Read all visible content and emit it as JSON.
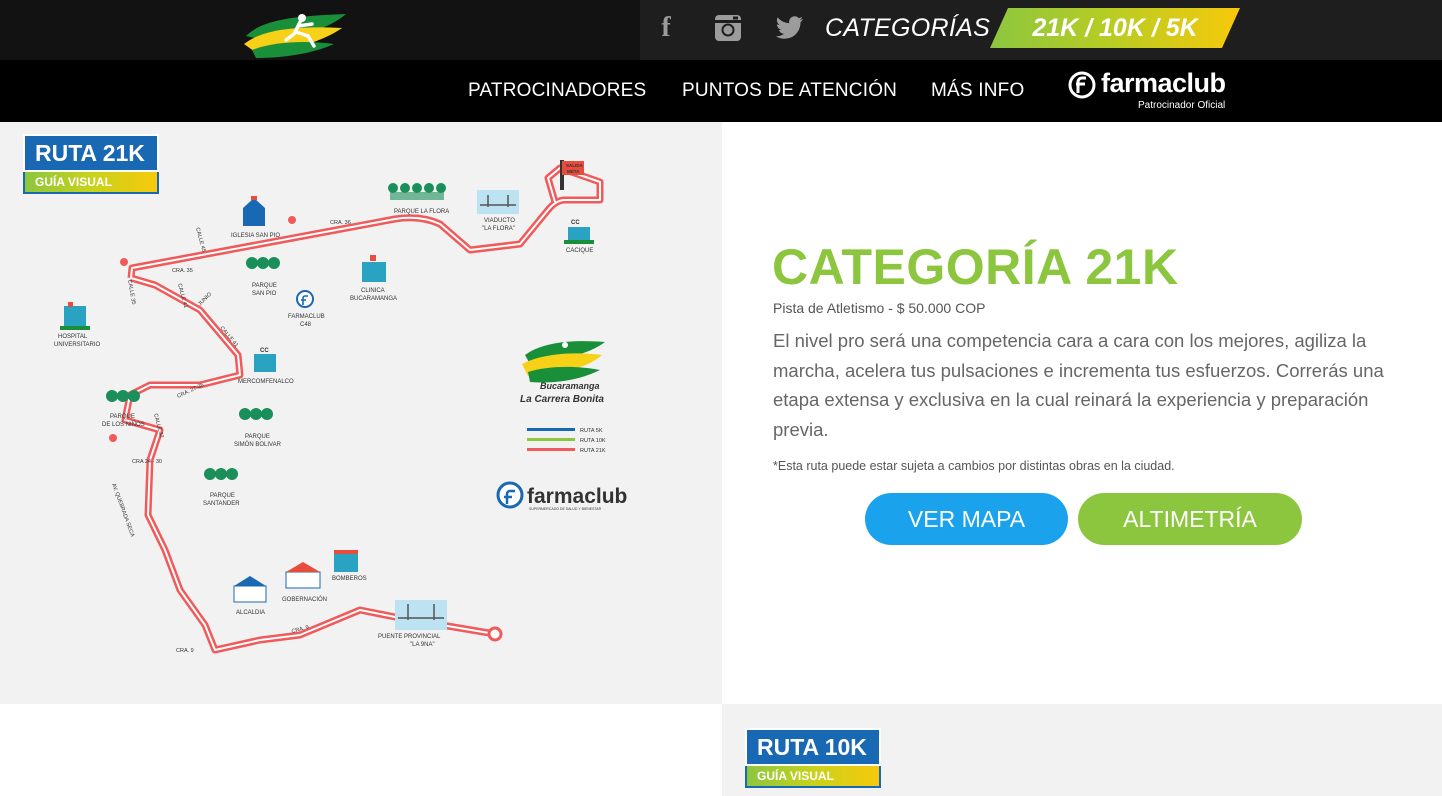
{
  "header": {
    "logo_icon": "brazil-runner-logo",
    "social": [
      {
        "name": "facebook",
        "glyph": "f"
      },
      {
        "name": "instagram"
      },
      {
        "name": "twitter"
      }
    ],
    "categorias_label": "CATEGORÍAS",
    "categories_badge": "21K / 10K / 5K"
  },
  "nav": {
    "items": [
      "PATROCINADORES",
      "PUNTOS DE ATENCIÓN",
      "MÁS INFO"
    ],
    "sponsor_name": "farmaclub",
    "sponsor_sub": "Patrocinador Oficial"
  },
  "map": {
    "badge_title": "RUTA 21K",
    "badge_sub": "GUÍA VISUAL",
    "route_color": "#f05a5a",
    "labels": {
      "salida_meta": [
        "SALIDA",
        "META"
      ],
      "parque_la_flora": "PARQUE LA FLORA",
      "viaducto": [
        "VIADUCTO",
        "\"LA FLORA\""
      ],
      "cacique": "CACIQUE",
      "iglesia": "IGLESIA SAN PIO",
      "parque_san_pio": [
        "PARQUE",
        "SAN PIO"
      ],
      "clinica": [
        "CLINICA",
        "BUCARAMANGA"
      ],
      "farmaclub_c48": [
        "FARMACLUB",
        "C48"
      ],
      "hospital": [
        "HOSPITAL",
        "UNIVERSITARIO"
      ],
      "mercomfenalco": "MERCOMFENALCO",
      "parque_ninos": [
        "PARQUE",
        "DE LOS NIÑOS"
      ],
      "parque_bolivar": [
        "PARQUE",
        "SIMÓN BOLIVAR"
      ],
      "parque_santander": [
        "PARQUE",
        "SANTANDER"
      ],
      "bomberos": "BOMBEROS",
      "gobernacion": "GOBERNACIÓN",
      "alcaldia": "ALCALDIA",
      "puente": [
        "PUENTE PROVINCIAL",
        "\"LA 9NA\""
      ],
      "streets": [
        "CRA. 36",
        "CALLE 45",
        "CALLE 35",
        "CRA. 35",
        "CALLE 41",
        "JUNIO",
        "CALLE 41",
        "CRA. 27-36",
        "CALLE 32",
        "CRA 24 - 30",
        "AV. QUEBRADA SECA",
        "CRA. 9",
        "CRA. 9"
      ]
    },
    "legend": [
      {
        "label": "RUTA 5K",
        "color": "#1968b3"
      },
      {
        "label": "RUTA 10K",
        "color": "#8cc63f"
      },
      {
        "label": "RUTA 21K",
        "color": "#f05a5a"
      }
    ],
    "brand_line1": "Bucaramanga",
    "brand_line2": "La Carrera Bonita",
    "sponsor_name": "farmaclub",
    "sponsor_sub": "SUPERMERCADO DE SALUD Y BIENESTAR"
  },
  "info": {
    "title": "CATEGORÍA 21K",
    "price": "Pista de Atletismo - $ 50.000 COP",
    "description": "El nivel pro será una competencia cara a cara con los mejores, agiliza la marcha, acelera tus pulsaciones e incrementa tus esfuerzos. Correrás una etapa extensa y exclusiva en la cual reinará la experiencia y preparación previa.",
    "note": "*Esta ruta puede estar sujeta a cambios por distintas obras en la ciudad.",
    "btn_map": "VER MAPA",
    "btn_alt": "ALTIMETRÍA"
  },
  "next_route": {
    "badge_title": "RUTA 10K",
    "badge_sub": "GUÍA VISUAL"
  }
}
